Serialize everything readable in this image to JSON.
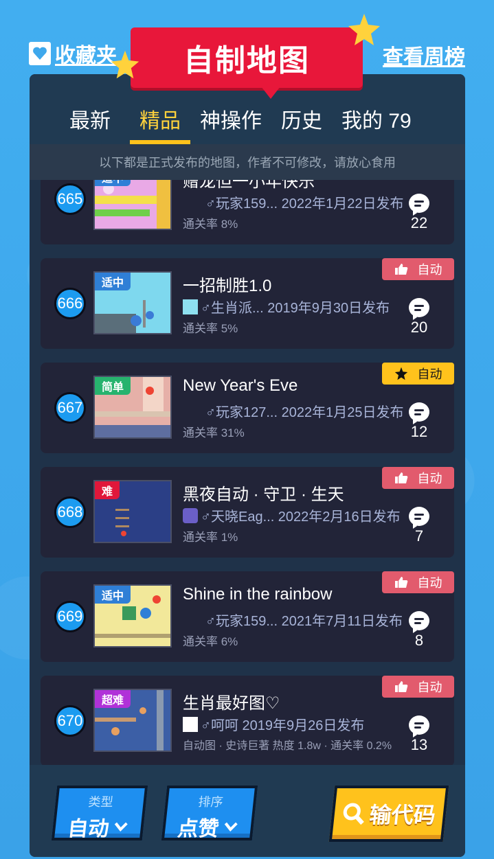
{
  "header": {
    "favorites_label": "收藏夹",
    "banner_title": "自制地图",
    "weekly_label": "查看周榜"
  },
  "tabs": [
    {
      "label": "最新",
      "active": false
    },
    {
      "label": "精品",
      "active": true
    },
    {
      "label": "神操作",
      "active": false
    },
    {
      "label": "历史",
      "active": false
    },
    {
      "label": "我的 79",
      "active": false
    }
  ],
  "notice": "以下都是正式发布的地图，作者不可修改，请放心食用",
  "maps": [
    {
      "rank": "665",
      "difficulty": "适中",
      "difficulty_color": "#2f7fd6",
      "title": "赠龙但一小年快乐",
      "author": "♂玩家159... 2022年1月22日发布",
      "rate": "通关率 8%",
      "tag_icon": "",
      "tag_label": "",
      "comments": "22",
      "thumb_color": "#e9a9e6"
    },
    {
      "rank": "666",
      "difficulty": "适中",
      "difficulty_color": "#2f7fd6",
      "title": "一招制胜1.0",
      "author": "♂生肖派... 2019年9月30日发布",
      "rate": "通关率 5%",
      "tag_icon": "thumbs-up-icon",
      "tag_label": "自动",
      "comments": "20",
      "thumb_color": "#7ed8ee"
    },
    {
      "rank": "667",
      "difficulty": "简单",
      "difficulty_color": "#27b36e",
      "title": "New Year's Eve",
      "author": "♂玩家127... 2022年1月25日发布",
      "rate": "通关率 31%",
      "tag_icon": "star-icon",
      "tag_label": "自动",
      "comments": "12",
      "thumb_color": "#e6b0a8"
    },
    {
      "rank": "668",
      "difficulty": "难",
      "difficulty_color": "#e0173a",
      "title": "黑夜自动 · 守卫 · 生天",
      "author": "♂天晓Eag... 2022年2月16日发布",
      "rate": "通关率 1%",
      "tag_icon": "thumbs-up-icon",
      "tag_label": "自动",
      "comments": "7",
      "thumb_color": "#2b3f86"
    },
    {
      "rank": "669",
      "difficulty": "适中",
      "difficulty_color": "#2f7fd6",
      "title": "Shine in the rainbow",
      "author": "♂玩家159... 2021年7月11日发布",
      "rate": "通关率 6%",
      "tag_icon": "thumbs-up-icon",
      "tag_label": "自动",
      "comments": "8",
      "thumb_color": "#f2e89a"
    },
    {
      "rank": "670",
      "difficulty": "超难",
      "difficulty_color": "#b032d8",
      "title": "生肖最好图♡",
      "author": "♂呵呵 2019年9月26日发布",
      "rate": "自动图 · 史诗巨著 热度 1.8w · 通关率 0.2%",
      "tag_icon": "thumbs-up-icon",
      "tag_label": "自动",
      "comments": "13",
      "thumb_color": "#3c5fa6"
    }
  ],
  "bottom": {
    "type_label": "类型",
    "type_value": "自动",
    "sort_label": "排序",
    "sort_value": "点赞",
    "code_button": "输代码"
  },
  "colors": {
    "accent": "#ffc21c",
    "banner": "#e8173a",
    "panel": "#1f3249",
    "card": "#222438"
  }
}
